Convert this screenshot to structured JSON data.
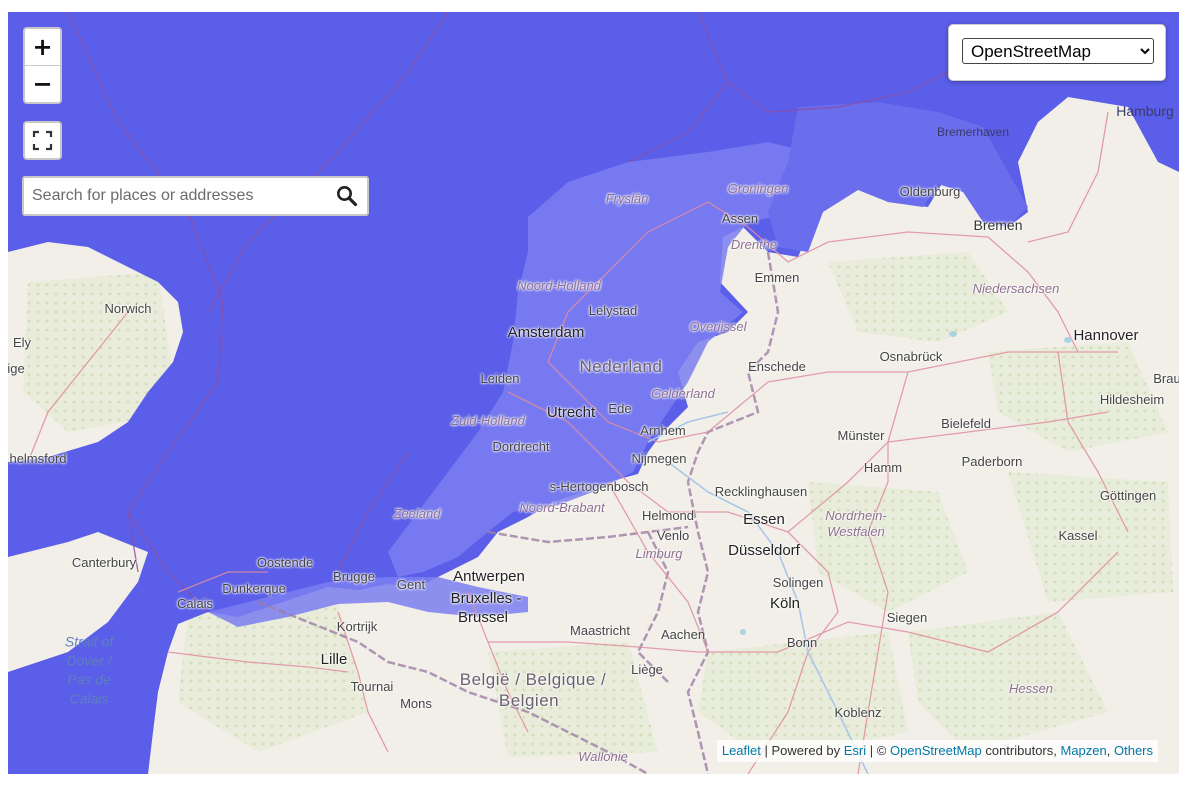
{
  "map": {
    "zoom_in_label": "+",
    "zoom_out_label": "−",
    "fullscreen_icon": "fullscreen-icon",
    "search": {
      "placeholder": "Search for places or addresses",
      "value": "",
      "icon": "search-icon"
    },
    "layer_select": {
      "selected": "OpenStreetMap",
      "options": [
        "OpenStreetMap"
      ]
    },
    "attribution": {
      "leaflet": "Leaflet",
      "sep1": " | Powered by ",
      "esri": "Esri",
      "sep2": " | © ",
      "osm": "OpenStreetMap",
      "contributors": " contributors, ",
      "mapzen": "Mapzen",
      "comma": ", ",
      "others": "Others"
    },
    "colors": {
      "flood": "#5a5ee8",
      "land": "#f2efe9",
      "border": "#8e4f9a",
      "road": "#e08da1",
      "link": "#0078a8"
    },
    "labels": {
      "hamburg": "Hamburg",
      "bremerhaven": "Bremerhaven",
      "groningen": "Groningen",
      "fryslan": "Fryslân",
      "oldenburg": "Oldenburg",
      "assen": "Assen",
      "drenthe": "Drenthe",
      "bremen": "Bremen",
      "emmen": "Emmen",
      "niedersachsen": "Niedersachsen",
      "noord_holland": "Noord-Holland",
      "lelystad": "Lelystad",
      "norwich": "Norwich",
      "ely": "Ely",
      "ige": "ige",
      "amsterdam": "Amsterdam",
      "overijssel": "Overijssel",
      "hannover": "Hannover",
      "nederland": "Nederland",
      "enschede": "Enschede",
      "osnabruck": "Osnabrück",
      "leiden": "Leiden",
      "brau": "Brau",
      "gelderland": "Gelderland",
      "utrecht": "Utrecht",
      "ede": "Ede",
      "hildesheim": "Hildesheim",
      "zuid_holland": "Zuid-Holland",
      "arnhem": "Arnhem",
      "bielefeld": "Bielefeld",
      "munster": "Münster",
      "dordrecht": "Dordrecht",
      "helmsford": "helmsford",
      "nijmegen": "Nijmegen",
      "hamm": "Hamm",
      "paderborn": "Paderborn",
      "hertogenbosch": "s-Hertogenbosch",
      "recklinghausen": "Recklinghausen",
      "gottingen": "Göttingen",
      "zeeland": "Zeeland",
      "noord_brabant": "Noord-Brabant",
      "helmond": "Helmond",
      "essen": "Essen",
      "nordrhein": "Nordrhein-",
      "westfalen": "Westfalen",
      "venlo": "Venlo",
      "kassel": "Kassel",
      "canterbury": "Canterbury",
      "ostende": "Oostende",
      "limburg": "Limburg",
      "dusseldorf": "Düsseldorf",
      "dunkerque": "Dunkerque",
      "brugge": "Brugge",
      "gent": "Gent",
      "antwerpen": "Antwerpen",
      "solingen": "Solingen",
      "calais": "Calais",
      "bruxelles": "Bruxelles -",
      "brussel": "Brussel",
      "koln": "Köln",
      "siegen": "Siegen",
      "kortrijk": "Kortrijk",
      "maastricht": "Maastricht",
      "aachen": "Aachen",
      "bonn": "Bonn",
      "strait_of": "Strait of",
      "dover": "Dover /",
      "pas_de": "Pas de",
      "calais_sea": "Calais",
      "lille": "Lille",
      "liege": "Liège",
      "belgie1": "België / Belgique /",
      "belgie2": "Belgien",
      "hessen": "Hessen",
      "tournai": "Tournai",
      "mons": "Mons",
      "koblenz": "Koblenz",
      "wallonie": "Wallonie"
    }
  }
}
